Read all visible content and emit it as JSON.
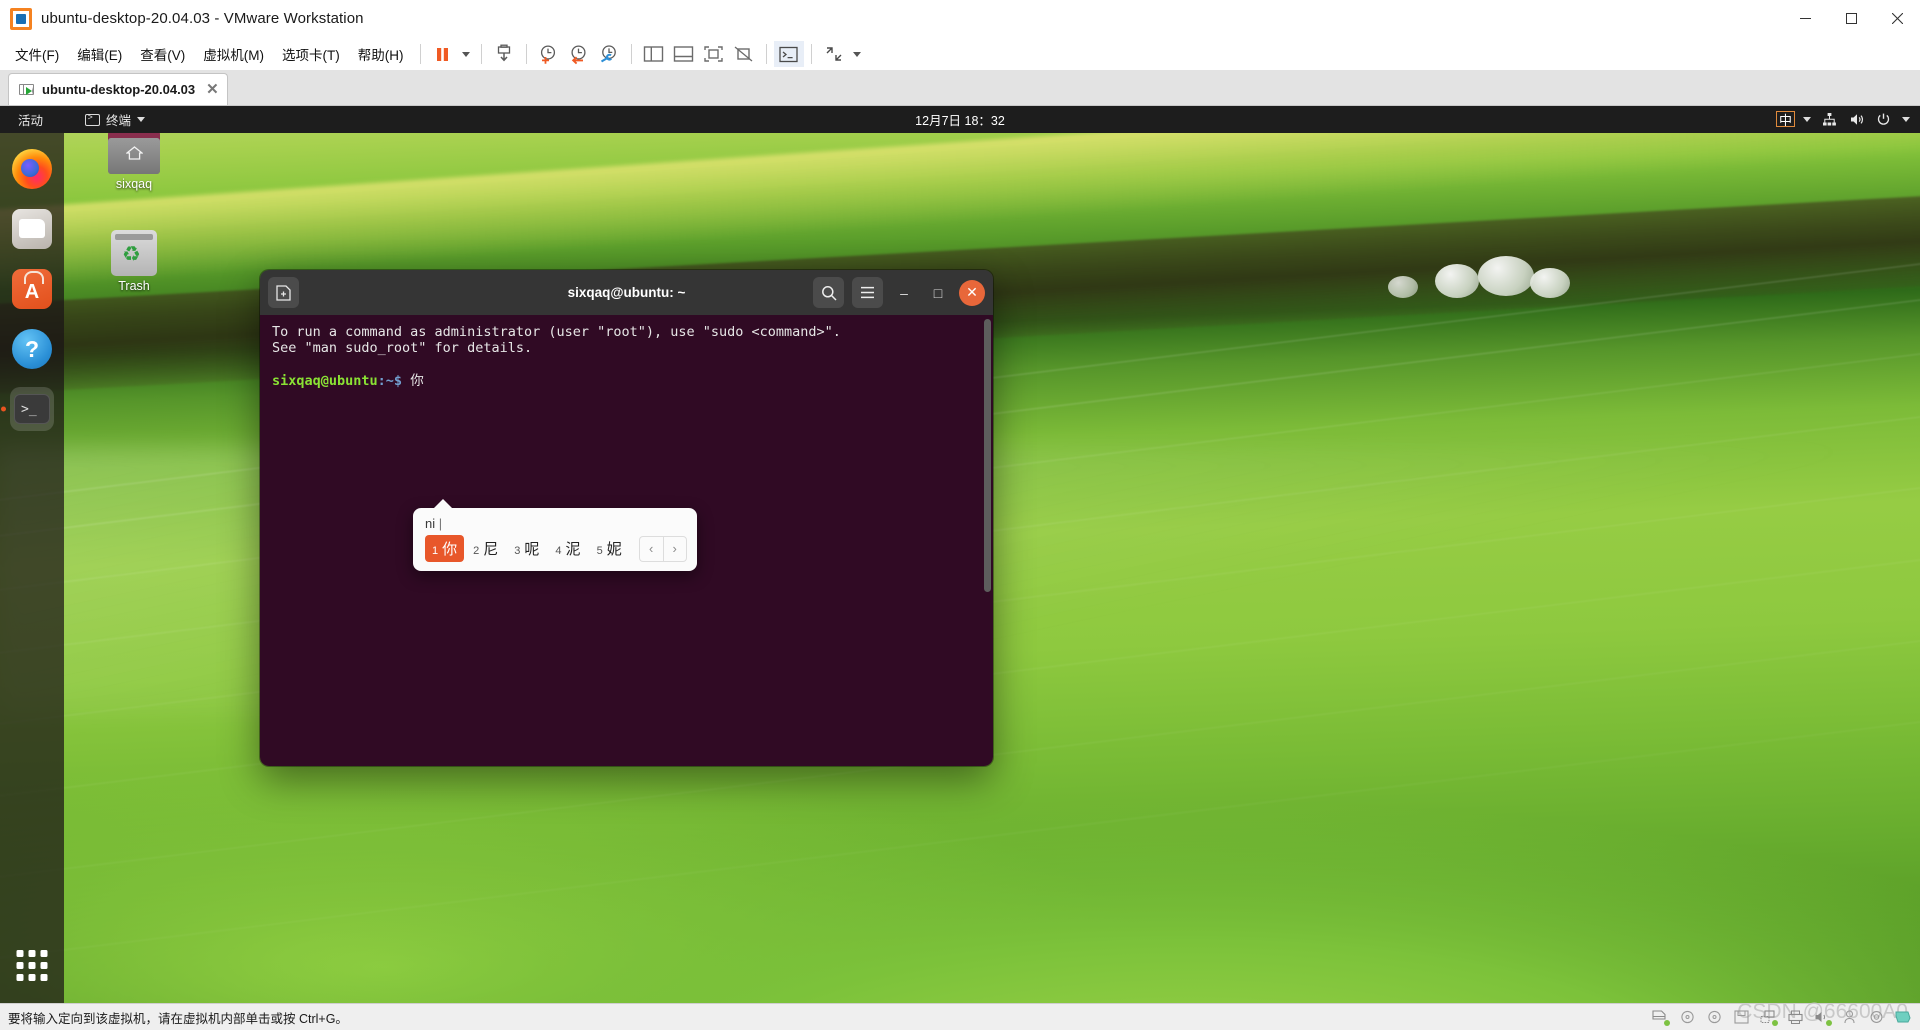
{
  "window": {
    "title": "ubuntu-desktop-20.04.03 - VMware Workstation",
    "minimize_label": "—",
    "maximize_label": "❐",
    "close_label": "✕"
  },
  "menubar": {
    "items": [
      {
        "label": "文件(F)",
        "key": "F",
        "name": "menu-file"
      },
      {
        "label": "编辑(E)",
        "key": "E",
        "name": "menu-edit"
      },
      {
        "label": "查看(V)",
        "key": "V",
        "name": "menu-view"
      },
      {
        "label": "虚拟机(M)",
        "key": "M",
        "name": "menu-vm"
      },
      {
        "label": "选项卡(T)",
        "key": "T",
        "name": "menu-tabs"
      },
      {
        "label": "帮助(H)",
        "key": "H",
        "name": "menu-help"
      }
    ],
    "toolbar_icons": [
      "pause-icon",
      "dropdown-caret-icon",
      "power-snapshot-icon",
      "take-snapshot-icon",
      "revert-snapshot-icon",
      "snapshot-manager-icon",
      "show-sidebar-icon",
      "show-console-icon",
      "full-screen-icon",
      "unity-mode-icon",
      "terminal-icon",
      "expand-icon"
    ]
  },
  "tabstrip": {
    "tabs": [
      {
        "label": "ubuntu-desktop-20.04.03",
        "close": "✕"
      }
    ]
  },
  "guest": {
    "panel": {
      "activities": "活动",
      "app_menu": "终端",
      "clock": "12月7日  18：32",
      "ime_indicator": "中",
      "icons": [
        "network-icon",
        "volume-icon",
        "power-icon",
        "chevron-down-icon"
      ]
    },
    "dock": {
      "items": [
        {
          "name": "dock-item-firefox",
          "label": "Firefox"
        },
        {
          "name": "dock-item-files",
          "label": "Files"
        },
        {
          "name": "dock-item-ubuntu-software",
          "label": "Ubuntu Software"
        },
        {
          "name": "dock-item-help",
          "label": "Help"
        },
        {
          "name": "dock-item-terminal",
          "label": "Terminal"
        }
      ],
      "show_apps_label": "Show Applications"
    },
    "desktop_icons": [
      {
        "name": "desktop-icon-home",
        "label": "sixqaq"
      },
      {
        "name": "desktop-icon-trash",
        "label": "Trash"
      }
    ],
    "terminal": {
      "title": "sixqaq@ubuntu: ~",
      "new_tab_label": "+",
      "search_label": "",
      "menu_label": "☰",
      "minimize_label": "–",
      "maximize_label": "□",
      "close_label": "✕",
      "lines": [
        "To run a command as administrator (user \"root\"), use \"sudo <command>\".",
        "See \"man sudo_root\" for details."
      ],
      "prompt_user": "sixqaq@ubuntu",
      "prompt_path": ":~$",
      "typed_text": "你"
    },
    "ime": {
      "preedit": "ni",
      "cursor": "|",
      "candidates": [
        {
          "num": "1",
          "text": "你",
          "selected": true
        },
        {
          "num": "2",
          "text": "尼",
          "selected": false
        },
        {
          "num": "3",
          "text": "呢",
          "selected": false
        },
        {
          "num": "4",
          "text": "泥",
          "selected": false
        },
        {
          "num": "5",
          "text": "妮",
          "selected": false
        }
      ],
      "prev_label": "‹",
      "next_label": "›"
    }
  },
  "statusbar": {
    "hint": "要将输入定向到该虚拟机，请在虚拟机内部单击或按 Ctrl+G。",
    "watermark": "CSDN @66600A0",
    "device_icons": [
      "hard-disk-icon",
      "cd-drive-icon",
      "cd-drive-2-icon",
      "floppy-icon",
      "network-adapter-icon",
      "printer-icon",
      "sound-card-icon",
      "usb-icon",
      "camera-icon",
      "display-icon"
    ]
  },
  "colors": {
    "accent": "#e95420",
    "terminal_bg": "#300a24",
    "panel_bg": "#1d1d1d",
    "ime_select": "#e8572a"
  }
}
